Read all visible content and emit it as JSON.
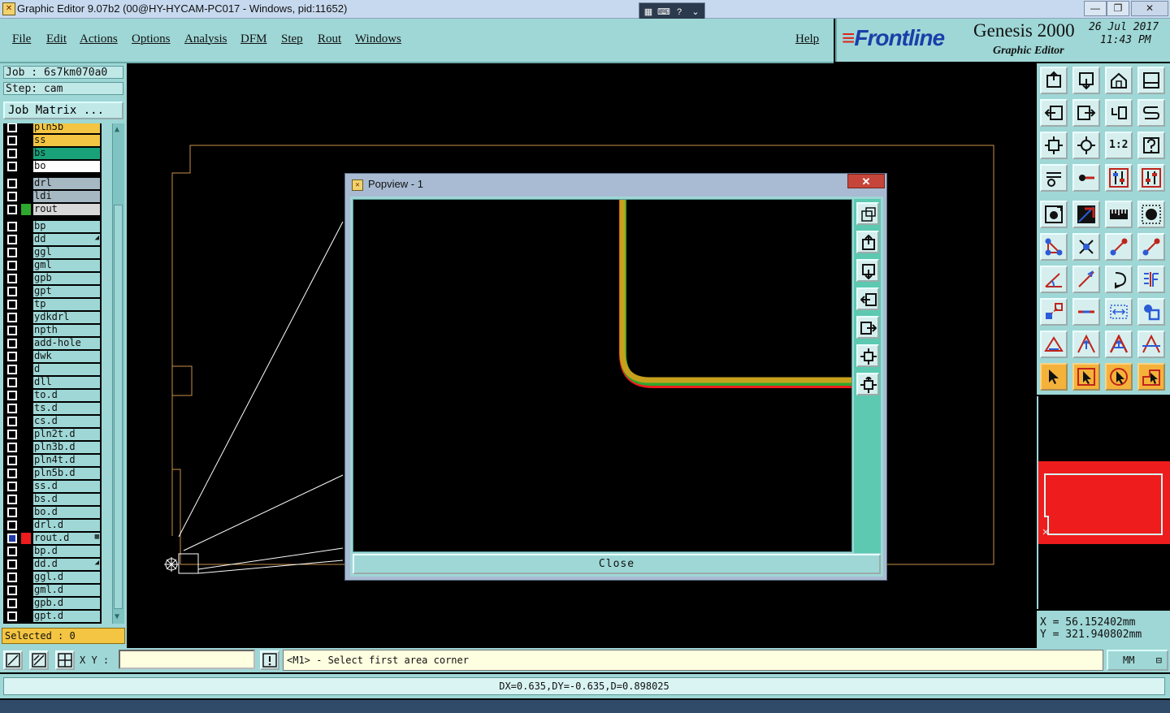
{
  "window": {
    "title": "Graphic Editor 9.07b2 (00@HY-HYCAM-PC017 - Windows, pid:11652)",
    "minimize": "—",
    "maximize": "❐",
    "close": "✕"
  },
  "menu": {
    "items": [
      "File",
      "Edit",
      "Actions",
      "Options",
      "Analysis",
      "DFM",
      "Step",
      "Rout",
      "Windows"
    ],
    "help": "Help"
  },
  "brand": {
    "logo": "Frontline",
    "product": "Genesis 2000",
    "subtitle": "Graphic Editor",
    "date": "26 Jul 2017",
    "time": "11:43 PM"
  },
  "job": {
    "job_line": "Job : 6s7km070a0",
    "step_line": "Step: cam",
    "matrix_button": "Job Matrix ..."
  },
  "layers": [
    {
      "name": "pln5b",
      "color": "#f4c542",
      "checked": false
    },
    {
      "name": "ss",
      "color": "#f4c542",
      "checked": false
    },
    {
      "name": "bs",
      "color": "#19a27a",
      "checked": false
    },
    {
      "name": "bo",
      "color": "#ffffff",
      "checked": false
    },
    {
      "name": "drl",
      "color": "#a6b8c2",
      "checked": false
    },
    {
      "name": "ldi",
      "color": "#a6b8c2",
      "checked": false
    },
    {
      "name": "rout",
      "color": "#d8d8d8",
      "checked": false,
      "swatch": "#2ea82e"
    },
    {
      "name": "bp",
      "color": "#9ed7d6",
      "checked": false
    },
    {
      "name": "dd",
      "color": "#9ed7d6",
      "checked": false,
      "mark": "◢"
    },
    {
      "name": "ggl",
      "color": "#9ed7d6",
      "checked": false
    },
    {
      "name": "gml",
      "color": "#9ed7d6",
      "checked": false
    },
    {
      "name": "gpb",
      "color": "#9ed7d6",
      "checked": false
    },
    {
      "name": "gpt",
      "color": "#9ed7d6",
      "checked": false
    },
    {
      "name": "tp",
      "color": "#9ed7d6",
      "checked": false
    },
    {
      "name": "ydkdrl",
      "color": "#9ed7d6",
      "checked": false
    },
    {
      "name": "npth",
      "color": "#9ed7d6",
      "checked": false
    },
    {
      "name": "add-hole",
      "color": "#9ed7d6",
      "checked": false
    },
    {
      "name": "dwk",
      "color": "#9ed7d6",
      "checked": false
    },
    {
      "name": "d",
      "color": "#9ed7d6",
      "checked": false
    },
    {
      "name": "dll",
      "color": "#9ed7d6",
      "checked": false
    },
    {
      "name": "to.d",
      "color": "#9ed7d6",
      "checked": false
    },
    {
      "name": "ts.d",
      "color": "#9ed7d6",
      "checked": false
    },
    {
      "name": "cs.d",
      "color": "#9ed7d6",
      "checked": false
    },
    {
      "name": "pln2t.d",
      "color": "#9ed7d6",
      "checked": false
    },
    {
      "name": "pln3b.d",
      "color": "#9ed7d6",
      "checked": false
    },
    {
      "name": "pln4t.d",
      "color": "#9ed7d6",
      "checked": false
    },
    {
      "name": "pln5b.d",
      "color": "#9ed7d6",
      "checked": false
    },
    {
      "name": "ss.d",
      "color": "#9ed7d6",
      "checked": false
    },
    {
      "name": "bs.d",
      "color": "#9ed7d6",
      "checked": false
    },
    {
      "name": "bo.d",
      "color": "#9ed7d6",
      "checked": false
    },
    {
      "name": "drl.d",
      "color": "#9ed7d6",
      "checked": false
    },
    {
      "name": "rout.d",
      "color": "#9ed7d6",
      "checked": true,
      "swatch": "#ee1c1c",
      "mark": "▦"
    },
    {
      "name": "bp.d",
      "color": "#9ed7d6",
      "checked": false
    },
    {
      "name": "dd.d",
      "color": "#9ed7d6",
      "checked": false,
      "mark": "◢"
    },
    {
      "name": "ggl.d",
      "color": "#9ed7d6",
      "checked": false
    },
    {
      "name": "gml.d",
      "color": "#9ed7d6",
      "checked": false
    },
    {
      "name": "gpb.d",
      "color": "#9ed7d6",
      "checked": false
    },
    {
      "name": "gpt.d",
      "color": "#9ed7d6",
      "checked": false
    }
  ],
  "selected": "Selected : 0",
  "popview": {
    "title": "Popview - 1",
    "close_x": "✕",
    "close_button": "Close"
  },
  "coords": {
    "x": "X  =  56.152402mm",
    "y": "Y  = 321.940802mm"
  },
  "status": {
    "xy_label": "X Y :",
    "xy_value": "",
    "message": "<M1> - Select first area corner",
    "units": "MM",
    "dx": "DX=0.635,DY=-0.635,D=0.898025"
  },
  "labels": {
    "one_two": "1:2"
  }
}
